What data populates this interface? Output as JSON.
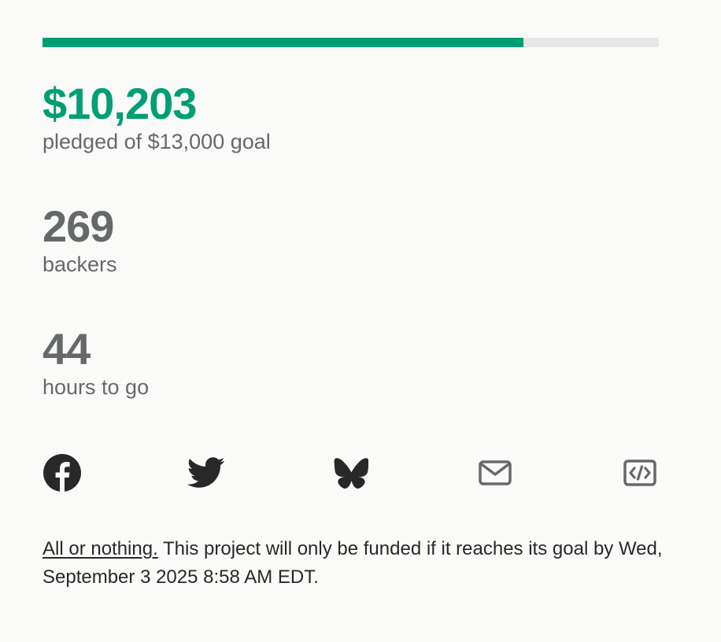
{
  "progress": {
    "funded_percent": 78,
    "accent_color": "#009e74",
    "track_color": "#e6e6e6"
  },
  "stats": {
    "pledged_amount": "$10,203",
    "pledged_label": "pledged of $13,000 goal",
    "backers_count": "269",
    "backers_label": "backers",
    "time_left": "44",
    "time_left_label": "hours to go"
  },
  "share": {
    "icons": [
      "facebook-icon",
      "twitter-icon",
      "bluesky-icon",
      "email-icon",
      "embed-icon"
    ]
  },
  "funding_note": {
    "link_text": "All or nothing.",
    "text": " This project will only be funded if it reaches its goal by Wed, September 3 2025 8:58 AM EDT."
  }
}
